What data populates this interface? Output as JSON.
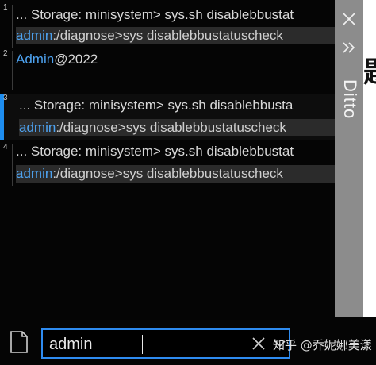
{
  "window": {
    "title": "Ditto"
  },
  "clips": [
    {
      "number": "1",
      "line1": "... Storage: minisystem> sys.sh disablebbustat",
      "line2_prefix": "admin",
      "line2_rest": ":/diagnose>sys disablebbustatuscheck"
    },
    {
      "number": "2",
      "line1_prefix": "Admin",
      "line1_rest": "@2022"
    },
    {
      "number": "3",
      "line1": "... Storage: minisystem> sys.sh disablebbusta",
      "line2_prefix": "admin",
      "line2_rest": ":/diagnose>sys disablebbustatuscheck"
    },
    {
      "number": "4",
      "line1": "... Storage: minisystem> sys.sh disablebbustat",
      "line2_prefix": "admin",
      "line2_rest": ":/diagnose>sys disablebbustatuscheck"
    }
  ],
  "search": {
    "value": "admin"
  },
  "watermark": "知乎 @乔妮娜美漾",
  "colors": {
    "accent": "#2e8bf0",
    "highlight_text": "#4ea3f1",
    "background": "#050505"
  },
  "icons": {
    "close": "close-icon",
    "more": "double-chevron-right-icon",
    "doc": "document-icon",
    "clear": "clear-x-icon",
    "dropdown": "chevron-down-icon"
  }
}
